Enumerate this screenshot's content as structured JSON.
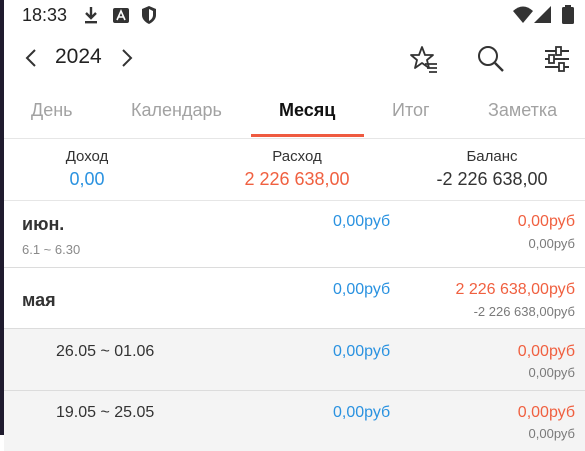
{
  "status": {
    "time": "18:33"
  },
  "header": {
    "year": "2024"
  },
  "tabs": [
    {
      "label": "День"
    },
    {
      "label": "Календарь"
    },
    {
      "label": "Месяц"
    },
    {
      "label": "Итог"
    },
    {
      "label": "Заметка"
    }
  ],
  "summary": {
    "income_label": "Доход",
    "income_value": "0,00",
    "expense_label": "Расход",
    "expense_value": "2 226 638,00",
    "balance_label": "Баланс",
    "balance_value": "-2 226 638,00"
  },
  "months": [
    {
      "name": "июн.",
      "range": "6.1 ~ 6.30",
      "income": "0,00руб",
      "expense": "0,00руб",
      "balance": "0,00руб"
    },
    {
      "name": "мая",
      "range": "",
      "income": "0,00руб",
      "expense": "2 226 638,00руб",
      "balance": "-2 226 638,00руб"
    }
  ],
  "weeks": [
    {
      "range": "26.05 ~ 01.06",
      "income": "0,00руб",
      "expense": "0,00руб",
      "balance": "0,00руб"
    },
    {
      "range": "19.05 ~ 25.05",
      "income": "0,00руб",
      "expense": "0,00руб",
      "balance": "0,00руб"
    }
  ],
  "colors": {
    "accent": "#ef5a40",
    "income": "#2a92e0",
    "expense": "#f06040"
  },
  "icons": [
    "download-icon",
    "a-badge-icon",
    "shield-icon",
    "wifi-icon",
    "signal-icon",
    "battery-icon",
    "chevron-left-icon",
    "chevron-right-icon",
    "star-list-icon",
    "search-icon",
    "filter-sliders-icon"
  ]
}
